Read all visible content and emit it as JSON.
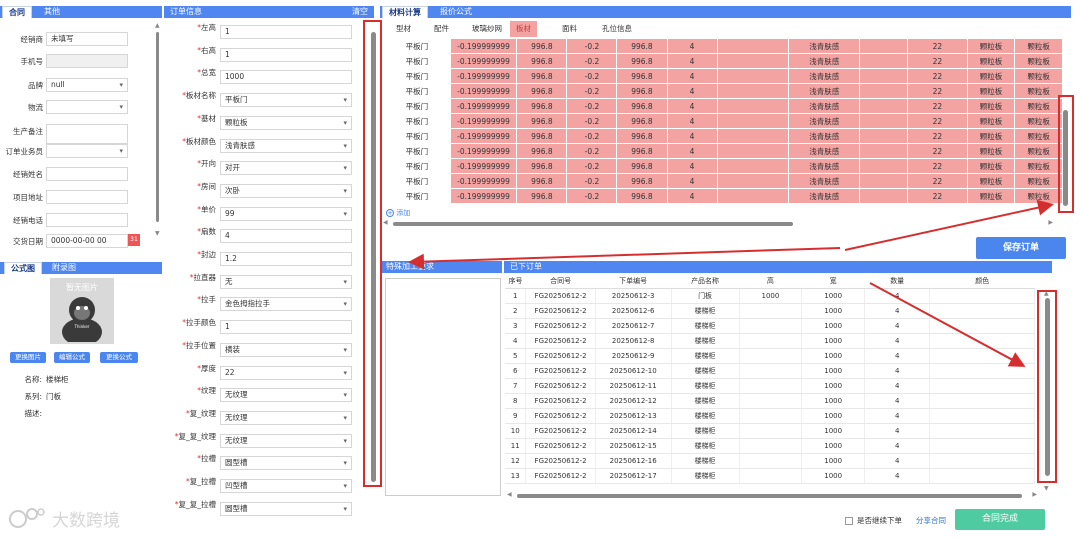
{
  "left": {
    "tabs": [
      "合同",
      "其他"
    ],
    "fields": [
      {
        "label": "经销商",
        "value": "未填写",
        "type": "text"
      },
      {
        "label": "手机号",
        "value": "",
        "type": "gray"
      },
      {
        "label": "品牌",
        "value": "null",
        "type": "select"
      },
      {
        "label": "物流",
        "value": "",
        "type": "select"
      },
      {
        "label": "生产备注",
        "value": "",
        "type": "textarea"
      },
      {
        "label": "订单业务员",
        "value": "",
        "type": "select"
      },
      {
        "label": "经销姓名",
        "value": "",
        "type": "text"
      },
      {
        "label": "项目地址",
        "value": "",
        "type": "text"
      },
      {
        "label": "经销电话",
        "value": "",
        "type": "text"
      },
      {
        "label": "交货日期",
        "value": "0000-00-00 00",
        "type": "date"
      }
    ],
    "formula_tabs": [
      "公式图",
      "附录图"
    ],
    "image_caption": "暂无图片",
    "buttons": [
      "更换图片",
      "编辑公式",
      "更换公式"
    ],
    "info": [
      {
        "label": "名称:",
        "value": "楼梯柜"
      },
      {
        "label": "系列:",
        "value": "门板"
      },
      {
        "label": "描述:",
        "value": ""
      }
    ]
  },
  "order_info": {
    "title": "订单信息",
    "clear": "清空",
    "fields": [
      {
        "label": "左高",
        "value": "1",
        "type": "text"
      },
      {
        "label": "右高",
        "value": "1",
        "type": "text"
      },
      {
        "label": "总宽",
        "value": "1000",
        "type": "text"
      },
      {
        "label": "板材名称",
        "value": "平板门",
        "type": "select"
      },
      {
        "label": "基材",
        "value": "颗粒板",
        "type": "select"
      },
      {
        "label": "板材颜色",
        "value": "浅青肤感",
        "type": "select"
      },
      {
        "label": "开向",
        "value": "对开",
        "type": "select"
      },
      {
        "label": "房间",
        "value": "次卧",
        "type": "select"
      },
      {
        "label": "单价",
        "value": "99",
        "type": "select"
      },
      {
        "label": "扇数",
        "value": "4",
        "type": "text"
      },
      {
        "label": "封边",
        "value": "1.2",
        "type": "text"
      },
      {
        "label": "拉直器",
        "value": "无",
        "type": "select"
      },
      {
        "label": "拉手",
        "value": "金色拇指拉手",
        "type": "select"
      },
      {
        "label": "拉手颜色",
        "value": "1",
        "type": "text"
      },
      {
        "label": "拉手位置",
        "value": "横装",
        "type": "select"
      },
      {
        "label": "厚度",
        "value": "22",
        "type": "select"
      },
      {
        "label": "纹理",
        "value": "无纹理",
        "type": "select"
      },
      {
        "label": "复_纹理",
        "value": "无纹理",
        "type": "select"
      },
      {
        "label": "复_复_纹理",
        "value": "无纹理",
        "type": "select"
      },
      {
        "label": "拉槽",
        "value": "圆型槽",
        "type": "select"
      },
      {
        "label": "复_拉槽",
        "value": "凹型槽",
        "type": "select"
      },
      {
        "label": "复_复_拉槽",
        "value": "圆型槽",
        "type": "select"
      }
    ]
  },
  "calc": {
    "tabs": [
      "材料计算",
      "报价公式"
    ],
    "subtabs": [
      "型材",
      "配件",
      "玻璃纱网",
      "板材",
      "面料",
      "孔位信息"
    ],
    "active_subtab": 3,
    "row": [
      "平板门",
      "-0.199999999",
      "996.8",
      "-0.2",
      "996.8",
      "4",
      "",
      "浅青肤感",
      "",
      "22",
      "颗粒板",
      "颗粒板"
    ],
    "row_count": 11,
    "add_label": "添加"
  },
  "save_button": "保存订单",
  "special": {
    "title": "特殊加工要求"
  },
  "orders": {
    "title": "已下订单",
    "columns": [
      "序号",
      "合同号",
      "下单编号",
      "产品名称",
      "高",
      "宽",
      "数量",
      "颜色"
    ],
    "rows": [
      [
        "1",
        "FG20250612-2",
        "20250612-3",
        "门板",
        "1000",
        "1000",
        "4",
        ""
      ],
      [
        "2",
        "FG20250612-2",
        "20250612-6",
        "楼梯柜",
        "",
        "1000",
        "4",
        ""
      ],
      [
        "3",
        "FG20250612-2",
        "20250612-7",
        "楼梯柜",
        "",
        "1000",
        "4",
        ""
      ],
      [
        "4",
        "FG20250612-2",
        "20250612-8",
        "楼梯柜",
        "",
        "1000",
        "4",
        ""
      ],
      [
        "5",
        "FG20250612-2",
        "20250612-9",
        "楼梯柜",
        "",
        "1000",
        "4",
        ""
      ],
      [
        "6",
        "FG20250612-2",
        "20250612-10",
        "楼梯柜",
        "",
        "1000",
        "4",
        ""
      ],
      [
        "7",
        "FG20250612-2",
        "20250612-11",
        "楼梯柜",
        "",
        "1000",
        "4",
        ""
      ],
      [
        "8",
        "FG20250612-2",
        "20250612-12",
        "楼梯柜",
        "",
        "1000",
        "4",
        ""
      ],
      [
        "9",
        "FG20250612-2",
        "20250612-13",
        "楼梯柜",
        "",
        "1000",
        "4",
        ""
      ],
      [
        "10",
        "FG20250612-2",
        "20250612-14",
        "楼梯柜",
        "",
        "1000",
        "4",
        ""
      ],
      [
        "11",
        "FG20250612-2",
        "20250612-15",
        "楼梯柜",
        "",
        "1000",
        "4",
        ""
      ],
      [
        "12",
        "FG20250612-2",
        "20250612-16",
        "楼梯柜",
        "",
        "1000",
        "4",
        ""
      ],
      [
        "13",
        "FG20250612-2",
        "20250612-17",
        "楼梯柜",
        "",
        "1000",
        "4",
        ""
      ]
    ]
  },
  "footer": {
    "continue_label": "是否继续下单",
    "share_label": "分享合同",
    "complete_button": "合同完成",
    "watermark": "大数跨境"
  },
  "colors": {
    "header_blue": "#4f86f0",
    "row_pink": "#f4a3a3",
    "complete_green": "#4ecba0",
    "annotation_red": "#d62e2e"
  }
}
